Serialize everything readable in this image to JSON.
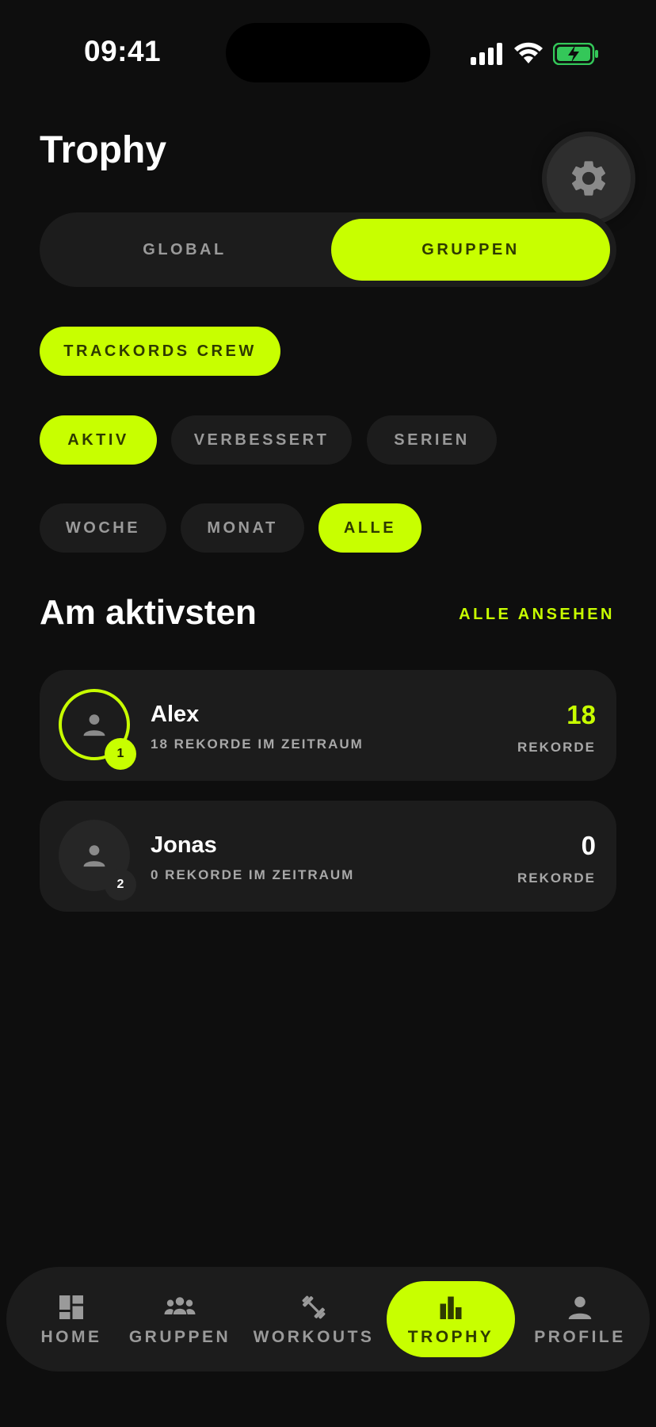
{
  "status_bar": {
    "time": "09:41"
  },
  "header": {
    "title": "Trophy"
  },
  "segments": {
    "global": "GLOBAL",
    "gruppen": "GRUPPEN"
  },
  "group_chip": "TRACKORDS CREW",
  "filters": [
    {
      "label": "AKTIV",
      "active": true
    },
    {
      "label": "VERBESSERT",
      "active": false
    },
    {
      "label": "SERIEN",
      "active": false
    }
  ],
  "periods": [
    {
      "label": "WOCHE",
      "active": false
    },
    {
      "label": "MONAT",
      "active": false
    },
    {
      "label": "ALLE",
      "active": true
    }
  ],
  "section": {
    "title": "Am aktivsten",
    "see_all": "ALLE ANSEHEN"
  },
  "leaderboard": [
    {
      "rank": "1",
      "name": "Alex",
      "subtitle": "18 REKORDE IM ZEITRAUM",
      "count": "18",
      "count_label": "REKORDE"
    },
    {
      "rank": "2",
      "name": "Jonas",
      "subtitle": "0 REKORDE IM ZEITRAUM",
      "count": "0",
      "count_label": "REKORDE"
    }
  ],
  "tabbar": [
    {
      "label": "HOME",
      "icon": "dashboard-icon"
    },
    {
      "label": "GRUPPEN",
      "icon": "group-icon"
    },
    {
      "label": "WORKOUTS",
      "icon": "dumbbell-icon"
    },
    {
      "label": "TROPHY",
      "icon": "bar-chart-icon",
      "active": true
    },
    {
      "label": "PROFILE",
      "icon": "person-icon"
    }
  ],
  "colors": {
    "accent": "#c8ff00",
    "background": "#0e0e0e",
    "card": "#1c1c1c",
    "muted_text": "#9a9a9a"
  }
}
